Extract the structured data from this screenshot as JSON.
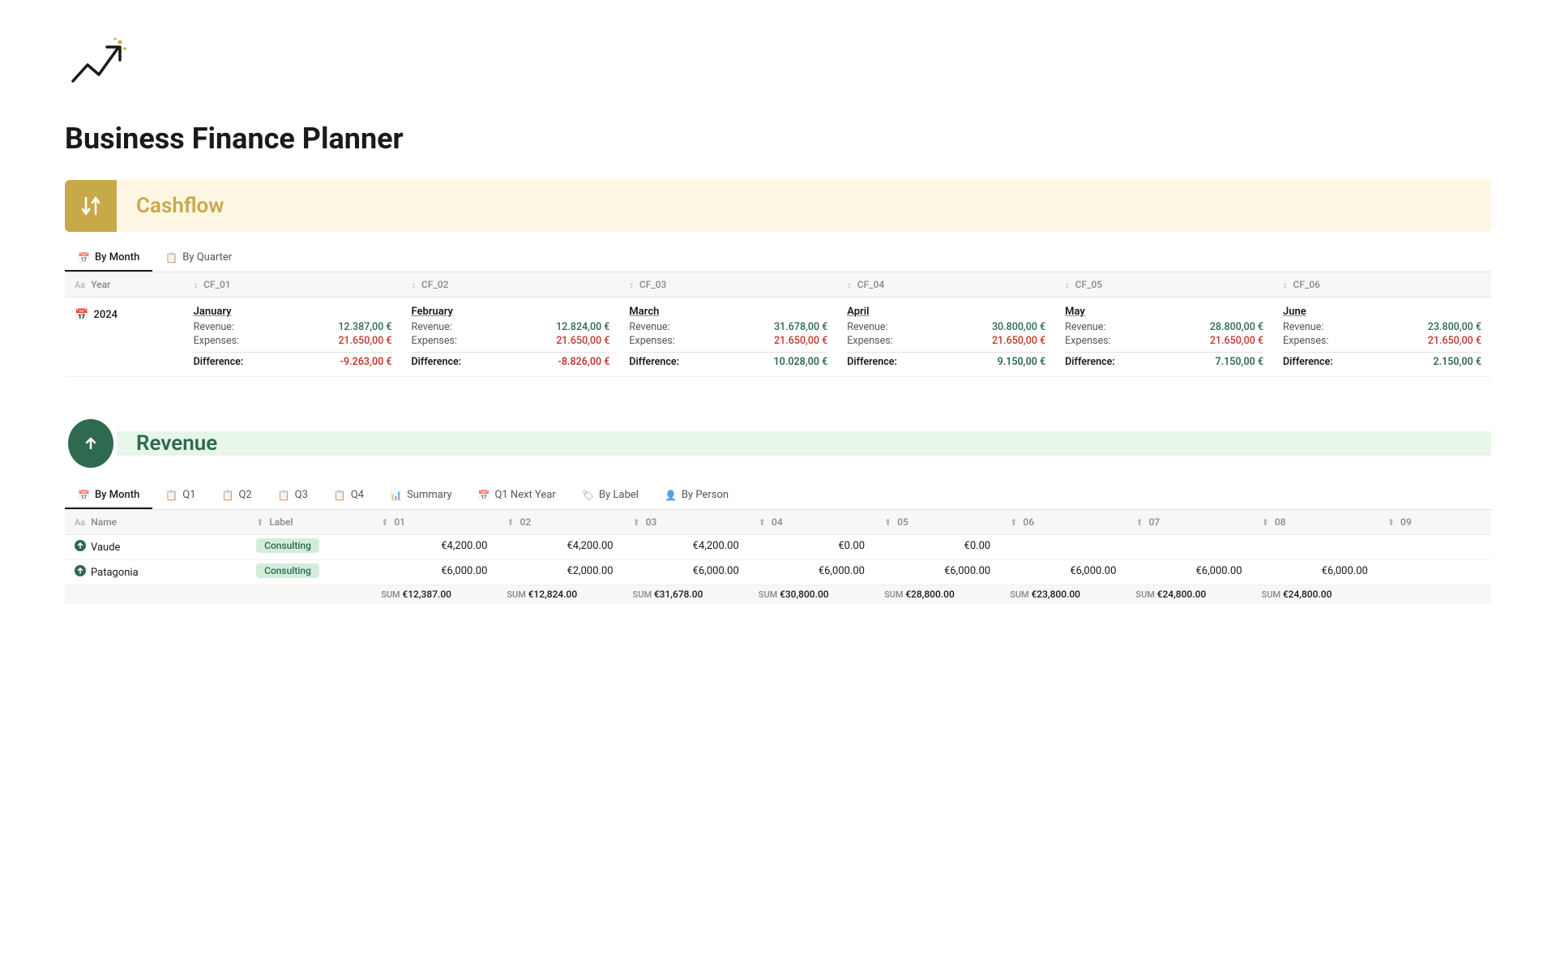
{
  "page": {
    "title": "Business Finance Planner",
    "logo_emoji": "📈"
  },
  "cashflow": {
    "section_title": "Cashflow",
    "icon": "↕",
    "tabs": [
      {
        "label": "By Month",
        "active": true,
        "icon": "📅"
      },
      {
        "label": "By Quarter",
        "active": false,
        "icon": "📋"
      }
    ],
    "columns": [
      {
        "id": "year",
        "label": "Year"
      },
      {
        "id": "CF_01",
        "label": "CF_01"
      },
      {
        "id": "CF_02",
        "label": "CF_02"
      },
      {
        "id": "CF_03",
        "label": "CF_03"
      },
      {
        "id": "CF_04",
        "label": "CF_04"
      },
      {
        "id": "CF_05",
        "label": "CF_05"
      },
      {
        "id": "CF_06",
        "label": "CF_06"
      }
    ],
    "rows": [
      {
        "year": "2024",
        "months": [
          {
            "name": "January",
            "revenue": "12.387,00 €",
            "expenses": "21.650,00 €",
            "difference": "-9.263,00 €",
            "diff_positive": false
          },
          {
            "name": "February",
            "revenue": "12.824,00 €",
            "expenses": "21.650,00 €",
            "difference": "-8.826,00 €",
            "diff_positive": false
          },
          {
            "name": "March",
            "revenue": "31.678,00 €",
            "expenses": "21.650,00 €",
            "difference": "10.028,00 €",
            "diff_positive": true
          },
          {
            "name": "April",
            "revenue": "30.800,00 €",
            "expenses": "21.650,00 €",
            "difference": "9.150,00 €",
            "diff_positive": true
          },
          {
            "name": "May",
            "revenue": "28.800,00 €",
            "expenses": "21.650,00 €",
            "difference": "7.150,00 €",
            "diff_positive": true
          },
          {
            "name": "June",
            "revenue": "23.800,00 €",
            "expenses": "21.650,00 €",
            "difference": "2.150,00 €",
            "diff_positive": true
          }
        ]
      }
    ]
  },
  "revenue": {
    "section_title": "Revenue",
    "icon": "⬆",
    "tabs": [
      {
        "label": "By Month",
        "active": true,
        "icon": "📅"
      },
      {
        "label": "Q1",
        "active": false,
        "icon": "📋"
      },
      {
        "label": "Q2",
        "active": false,
        "icon": "📋"
      },
      {
        "label": "Q3",
        "active": false,
        "icon": "📋"
      },
      {
        "label": "Q4",
        "active": false,
        "icon": "📋"
      },
      {
        "label": "Summary",
        "active": false,
        "icon": "📊"
      },
      {
        "label": "Q1 Next Year",
        "active": false,
        "icon": "📅"
      },
      {
        "label": "By Label",
        "active": false,
        "icon": "🏷"
      },
      {
        "label": "By Person",
        "active": false,
        "icon": "👤"
      }
    ],
    "columns": [
      {
        "id": "name",
        "label": "Name"
      },
      {
        "id": "label",
        "label": "Label"
      },
      {
        "id": "01",
        "label": "01"
      },
      {
        "id": "02",
        "label": "02"
      },
      {
        "id": "03",
        "label": "03"
      },
      {
        "id": "04",
        "label": "04"
      },
      {
        "id": "05",
        "label": "05"
      },
      {
        "id": "06",
        "label": "06"
      },
      {
        "id": "07",
        "label": "07"
      },
      {
        "id": "08",
        "label": "08"
      },
      {
        "id": "09",
        "label": "09"
      }
    ],
    "rows": [
      {
        "name": "Vaude",
        "label": "Consulting",
        "c01": "€4,200.00",
        "c02": "€4,200.00",
        "c03": "€4,200.00",
        "c04": "€0.00",
        "c05": "€0.00",
        "c06": "",
        "c07": "",
        "c08": "",
        "c09": ""
      },
      {
        "name": "Patagonia",
        "label": "Consulting",
        "c01": "€6,000.00",
        "c02": "€2,000.00",
        "c03": "€6,000.00",
        "c04": "€6,000.00",
        "c05": "€6,000.00",
        "c06": "€6,000.00",
        "c07": "€6,000.00",
        "c08": "€6,000.00",
        "c09": ""
      }
    ],
    "sums": {
      "c01": "€12,387.00",
      "c02": "€12,824.00",
      "c03": "€31,678.00",
      "c04": "€30,800.00",
      "c05": "€28,800.00",
      "c06": "€23,800.00",
      "c07": "€24,800.00",
      "c08": "€24,800.00"
    }
  }
}
